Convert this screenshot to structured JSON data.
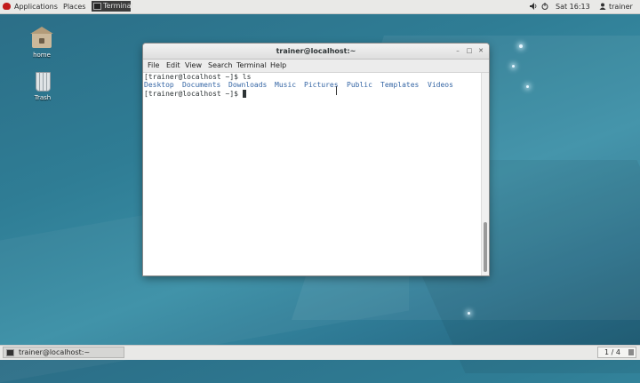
{
  "topbar": {
    "applications": "Applications",
    "places": "Places",
    "task_label": "Terminal",
    "clock": "Sat 16:13",
    "user": "trainer"
  },
  "desktop": {
    "icons": [
      {
        "label": "home",
        "icon": "home-folder-icon"
      },
      {
        "label": "Trash",
        "icon": "trash-icon"
      }
    ]
  },
  "window": {
    "title": "trainer@localhost:~",
    "menu": [
      "File",
      "Edit",
      "View",
      "Search",
      "Terminal",
      "Help"
    ],
    "lines": {
      "prompt1": "[trainer@localhost ~]$ ls",
      "prompt2": "[trainer@localhost ~]$ "
    },
    "dirs": [
      "Desktop",
      "Documents",
      "Downloads",
      "Music",
      "Pictures",
      "Public",
      "Templates",
      "Videos"
    ],
    "dir_color": "#3465a4"
  },
  "bottombar": {
    "task_label": "trainer@localhost:~",
    "workspace": "1 / 4"
  }
}
